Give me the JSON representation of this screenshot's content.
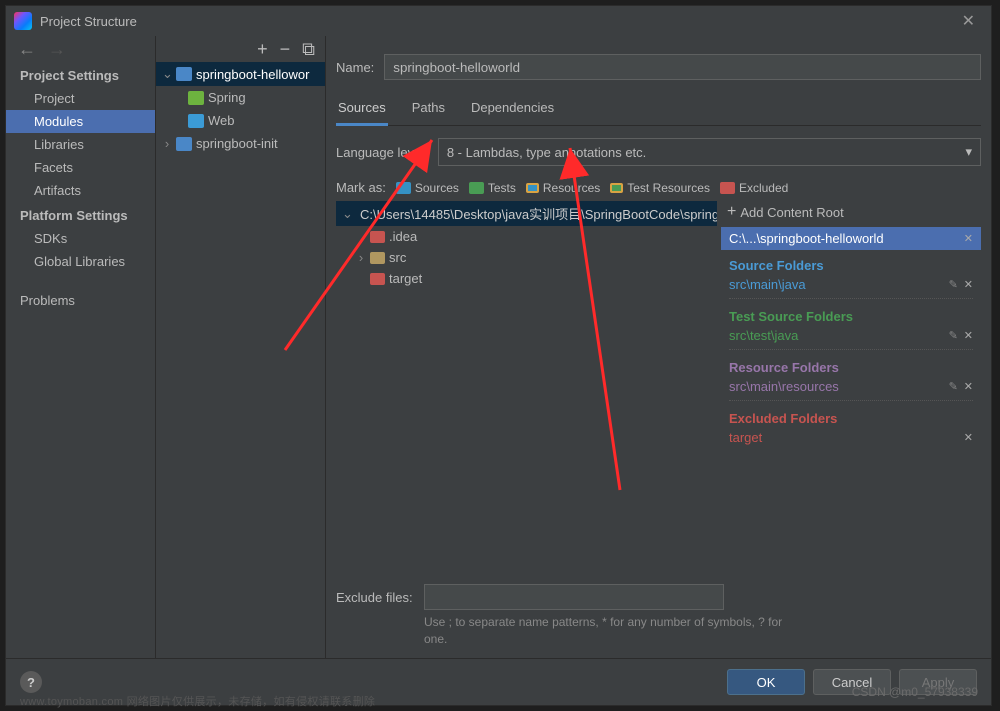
{
  "window": {
    "title": "Project Structure"
  },
  "sidebar": {
    "project_settings_label": "Project Settings",
    "platform_settings_label": "Platform Settings",
    "items": {
      "project": "Project",
      "modules": "Modules",
      "libraries": "Libraries",
      "facets": "Facets",
      "artifacts": "Artifacts",
      "sdks": "SDKs",
      "global_libraries": "Global Libraries",
      "problems": "Problems"
    }
  },
  "moduleTree": {
    "root": "springboot-hellowor",
    "spring": "Spring",
    "web": "Web",
    "second": "springboot-init"
  },
  "form": {
    "name_label": "Name:",
    "name_value": "springboot-helloworld",
    "language_level_label": "Language level:",
    "language_level_value": "8 - Lambdas, type annotations etc.",
    "mark_as_label": "Mark as:",
    "exclude_label": "Exclude files:",
    "hint": "Use ; to separate name patterns, * for any number of symbols, ? for one."
  },
  "tabs": {
    "sources": "Sources",
    "paths": "Paths",
    "dependencies": "Dependencies"
  },
  "markAs": {
    "sources": "Sources",
    "tests": "Tests",
    "resources": "Resources",
    "test_resources": "Test Resources",
    "excluded": "Excluded"
  },
  "contentTree": {
    "root": "C:\\Users\\14485\\Desktop\\java实训项目\\SpringBootCode\\spring",
    "idea": ".idea",
    "src": "src",
    "target": "target"
  },
  "rightPanel": {
    "add_content_root": "Add Content Root",
    "path_header": "C:\\...\\springboot-helloworld",
    "source_folders": "Source Folders",
    "source_path": "src\\main\\java",
    "test_source_folders": "Test Source Folders",
    "test_path": "src\\test\\java",
    "resource_folders": "Resource Folders",
    "resource_path": "src\\main\\resources",
    "excluded_folders": "Excluded Folders",
    "excluded_path": "target"
  },
  "buttons": {
    "ok": "OK",
    "cancel": "Cancel",
    "apply": "Apply"
  },
  "watermark": "CSDN @m0_57938339",
  "background_text": "www.toymoban.com 网络图片仅供展示，未存储，如有侵权请联系删除"
}
